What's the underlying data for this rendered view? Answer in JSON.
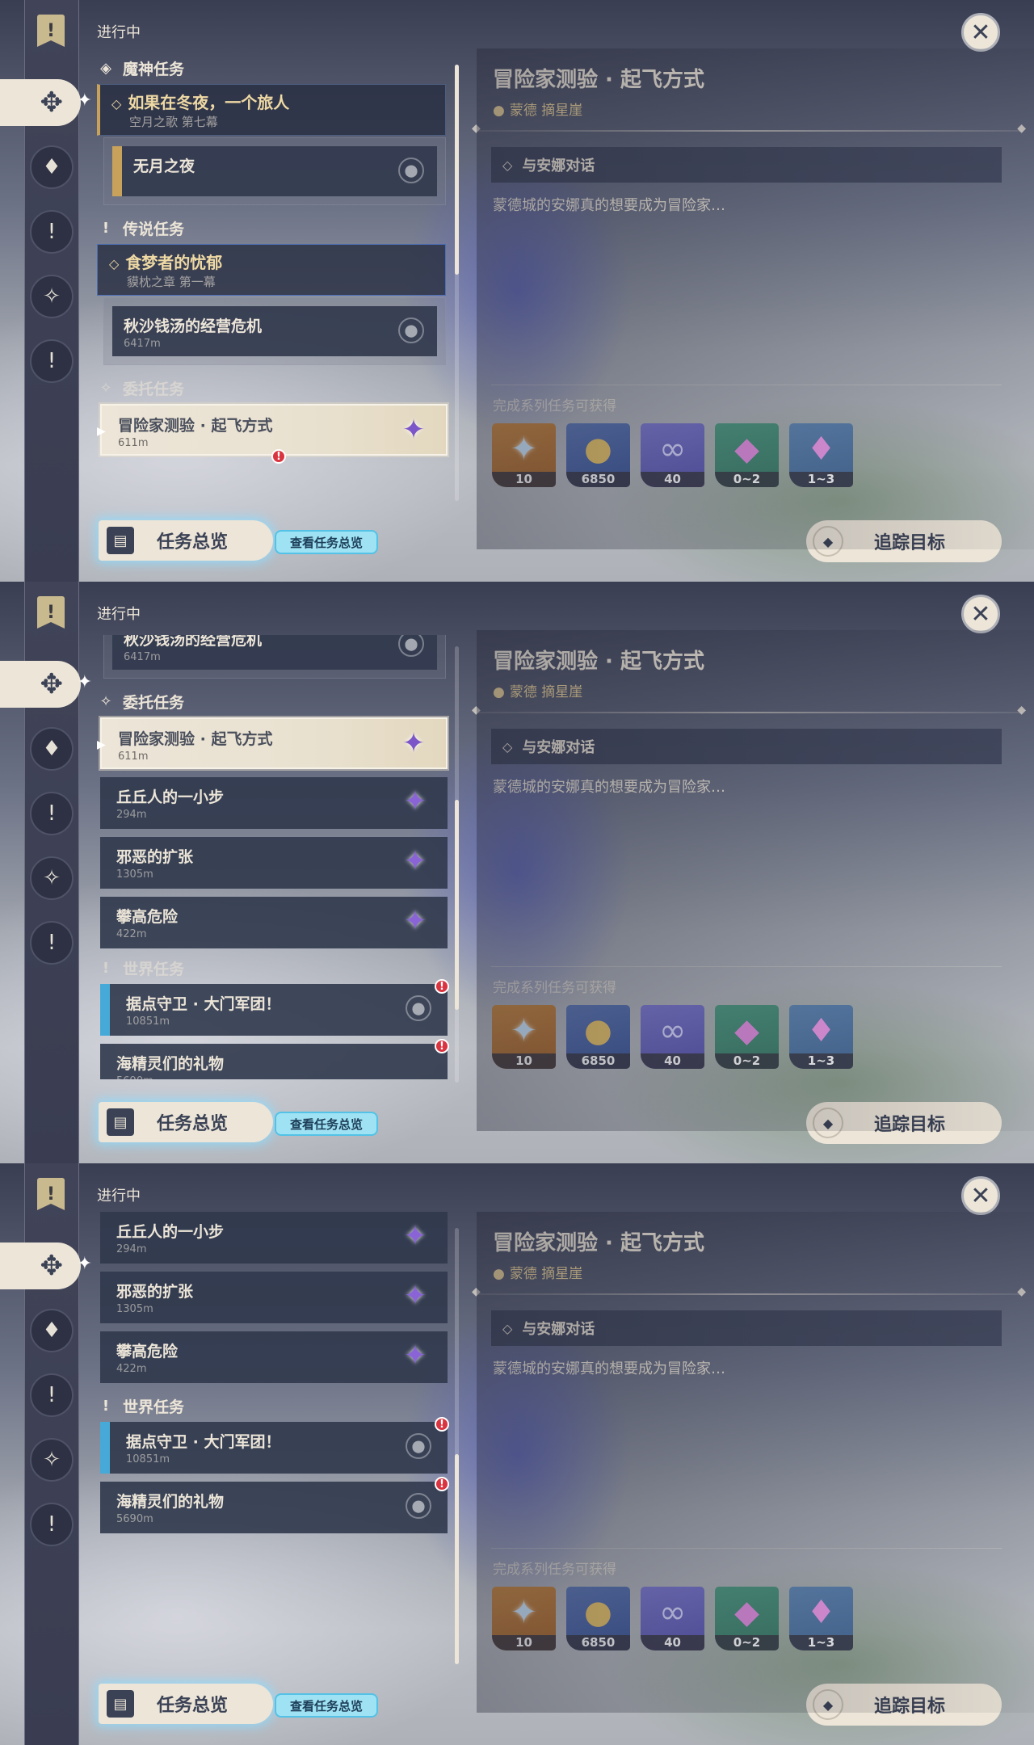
{
  "common": {
    "header_label": "进行中",
    "overview_label": "任务总览",
    "overview_tip": "查看任务总览",
    "track_label": "追踪目标",
    "close_glyph": "✕",
    "rail_top_glyph": "!",
    "rail_icons": [
      {
        "name": "quest-category-archon-icon",
        "glyph": "♦"
      },
      {
        "name": "quest-category-legend-icon",
        "glyph": "!"
      },
      {
        "name": "quest-category-commission-icon",
        "glyph": "✧"
      },
      {
        "name": "quest-category-world-icon",
        "glyph": "!"
      }
    ]
  },
  "detail": {
    "title": "冒险家测验 · 起飞方式",
    "location": "蒙德 摘星崖",
    "objective": "与安娜对话",
    "description": "蒙德城的安娜真的想要成为冒险家…",
    "reward_label": "完成系列任务可获得",
    "rewards": [
      {
        "name": "primogem-reward",
        "count": "10",
        "color": "#c88a45"
      },
      {
        "name": "mora-reward",
        "count": "6850",
        "color": "#5e79b6"
      },
      {
        "name": "adventure-exp-reward",
        "count": "40",
        "color": "#7e7ad0"
      },
      {
        "name": "enhancement-ore-reward",
        "count": "0~2",
        "color": "#4e9a82"
      },
      {
        "name": "fine-enhancement-ore-reward",
        "count": "1~3",
        "color": "#5f86b3"
      }
    ]
  },
  "sections": {
    "archon": "魔神任务",
    "legend": "传说任务",
    "commission": "委托任务",
    "world": "世界任务"
  },
  "quests": {
    "archon_group": {
      "title": "如果在冬夜，一个旅人",
      "subtitle": "空月之歌 第七幕"
    },
    "archon_sub": {
      "title": "无月之夜"
    },
    "legend_group": {
      "title": "食梦者的忧郁",
      "subtitle": "貘枕之章 第一幕"
    },
    "legend_sub": {
      "title": "秋沙钱汤的经营危机",
      "distance": "6417m"
    },
    "commissions": [
      {
        "title": "冒险家测验 · 起飞方式",
        "distance": "611m"
      },
      {
        "title": "丘丘人的一小步",
        "distance": "294m"
      },
      {
        "title": "邪恶的扩张",
        "distance": "1305m"
      },
      {
        "title": "攀高危险",
        "distance": "422m"
      }
    ],
    "world": [
      {
        "title": "据点守卫 · 大门军团！",
        "distance": "10851m"
      },
      {
        "title": "海精灵们的礼物",
        "distance": "5690m"
      }
    ]
  }
}
